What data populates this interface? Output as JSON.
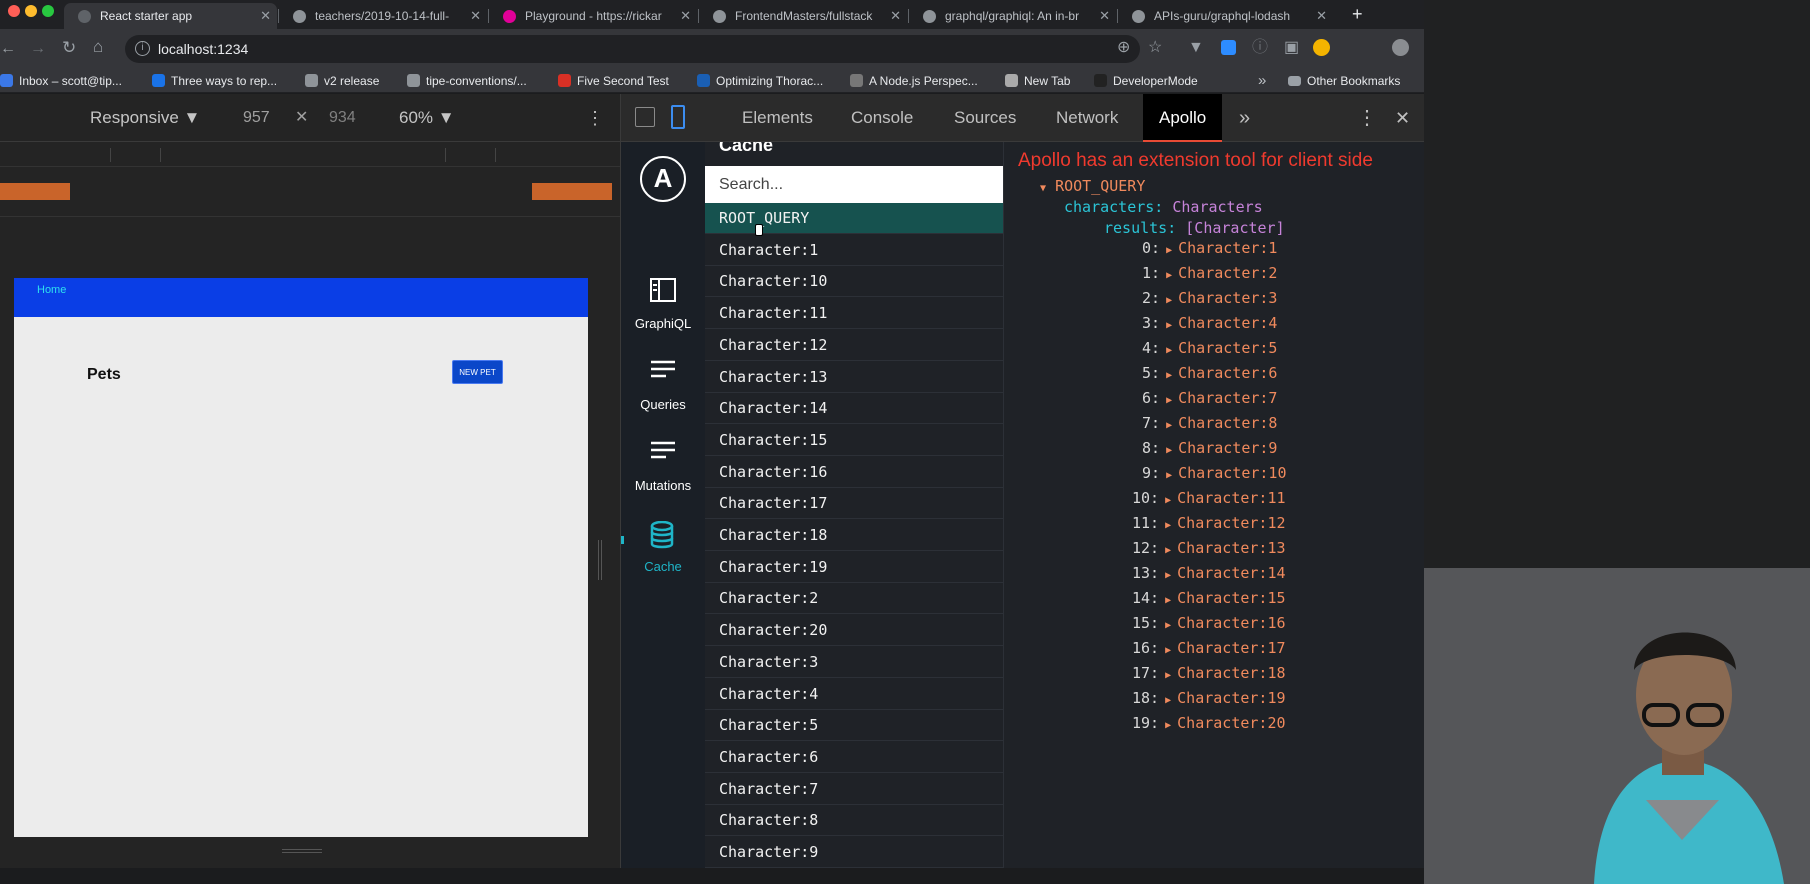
{
  "browser": {
    "tabs": [
      {
        "title": "React starter app",
        "active": true,
        "color": "#5f6368"
      },
      {
        "title": "teachers/2019-10-14-full-",
        "active": false,
        "color": "#8f9499"
      },
      {
        "title": "Playground - https://rickar",
        "active": false,
        "color": "#e10098"
      },
      {
        "title": "FrontendMasters/fullstack",
        "active": false,
        "color": "#8f9499"
      },
      {
        "title": "graphql/graphiql: An in-br",
        "active": false,
        "color": "#8f9499"
      },
      {
        "title": "APIs-guru/graphql-lodash",
        "active": false,
        "color": "#8f9499"
      }
    ],
    "close_glyph": "✕",
    "new_tab_glyph": "+",
    "url": "localhost:1234",
    "bookmarks": [
      {
        "label": "Inbox – scott@tip...",
        "color": "#3b78e7"
      },
      {
        "label": "Three ways to rep...",
        "color": "#1a73e8"
      },
      {
        "label": "v2 release",
        "color": "#8f9499"
      },
      {
        "label": "tipe-conventions/...",
        "color": "#8f9499"
      },
      {
        "label": "Five Second Test",
        "color": "#d93025"
      },
      {
        "label": "Optimizing Thorac...",
        "color": "#1a5fb4"
      },
      {
        "label": "A Node.js Perspec...",
        "color": "#777"
      },
      {
        "label": "New Tab",
        "color": "#aaa"
      },
      {
        "label": "DeveloperMode",
        "color": "#222"
      }
    ],
    "bookmarks_more": "»",
    "other_bookmarks": "Other Bookmarks"
  },
  "device_toolbar": {
    "mode": "Responsive ▼",
    "width": "957",
    "times": "✕",
    "height": "934",
    "zoom": "60% ▼",
    "menu": "⋮"
  },
  "app_page": {
    "nav_home": "Home",
    "heading": "Pets",
    "new_pet_button": "NEW PET"
  },
  "devtools": {
    "tabs": [
      "Elements",
      "Console",
      "Sources",
      "Network",
      "Apollo"
    ],
    "active_tab": "Apollo",
    "more": "»",
    "menu": "⋮",
    "close": "✕"
  },
  "apollo": {
    "logo_letter": "A",
    "nav": [
      {
        "label": "GraphiQL",
        "icon": "graphiql-icon"
      },
      {
        "label": "Queries",
        "icon": "list-icon"
      },
      {
        "label": "Mutations",
        "icon": "list-icon"
      },
      {
        "label": "Cache",
        "icon": "database-icon"
      }
    ],
    "cache_title": "Cache",
    "search_placeholder": "Search...",
    "cache_items": [
      "ROOT_QUERY",
      "Character:1",
      "Character:10",
      "Character:11",
      "Character:12",
      "Character:13",
      "Character:14",
      "Character:15",
      "Character:16",
      "Character:17",
      "Character:18",
      "Character:19",
      "Character:2",
      "Character:20",
      "Character:3",
      "Character:4",
      "Character:5",
      "Character:6",
      "Character:7",
      "Character:8",
      "Character:9"
    ],
    "annotation": "Apollo has an extension tool for client side",
    "detail": {
      "root": "ROOT_QUERY",
      "field": "characters:",
      "field_type": "Characters",
      "sub_field": "results:",
      "sub_type": "[Character]",
      "results": [
        "Character:1",
        "Character:2",
        "Character:3",
        "Character:4",
        "Character:5",
        "Character:6",
        "Character:7",
        "Character:8",
        "Character:9",
        "Character:10",
        "Character:11",
        "Character:12",
        "Character:13",
        "Character:14",
        "Character:15",
        "Character:16",
        "Character:17",
        "Character:18",
        "Character:19",
        "Character:20"
      ]
    }
  },
  "colors": {
    "chrome_dark": "#202124",
    "devtools_bg": "#242424",
    "apollo_teal": "#1fb5c8",
    "annotation_red": "#f03a2e",
    "nav_blue": "#0a3ee6"
  }
}
